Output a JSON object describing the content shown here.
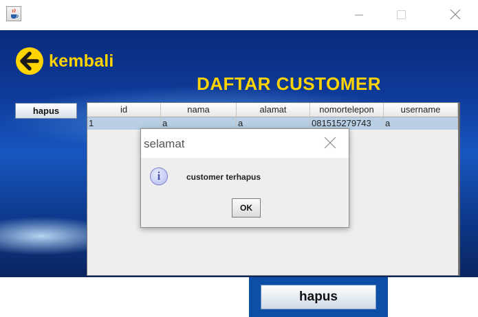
{
  "window": {
    "icons": {
      "app": "java-cup-icon",
      "minimize": "minimize-icon",
      "maximize": "maximize-icon",
      "close": "close-icon"
    }
  },
  "header": {
    "back_label": "kembali",
    "back_icon": "arrow-left-icon",
    "title": "DAFTAR CUSTOMER"
  },
  "toolbar": {
    "hapus_label": "hapus"
  },
  "table": {
    "columns": [
      "id",
      "nama",
      "alamat",
      "nomortelepon",
      "username"
    ],
    "rows": [
      [
        "1",
        "a",
        "a",
        "081515279743",
        "a"
      ]
    ]
  },
  "dialog": {
    "title": "selamat",
    "message": "customer terhapus",
    "ok_label": "OK",
    "icon": "info-icon"
  },
  "button_preview": {
    "label": "hapus"
  },
  "colors": {
    "accent_yellow": "#ffd400",
    "background_blue": "#0e3a98",
    "selected_row": "#b8cfe5"
  }
}
